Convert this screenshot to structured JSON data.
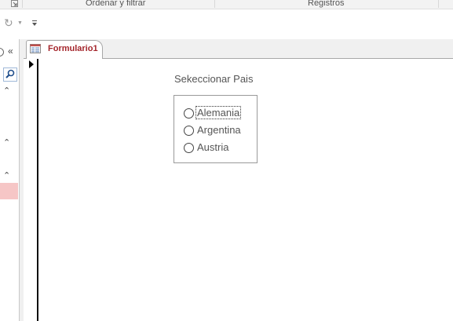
{
  "ribbon": {
    "groups": [
      {
        "label": "Ordenar y filtrar"
      },
      {
        "label": "Registros"
      }
    ]
  },
  "quick_access": {
    "items": [
      "redo-icon",
      "redo-dropdown-icon",
      "customize-qat-icon"
    ]
  },
  "navigation_pane": {
    "icons": [
      "shutter-open-icon",
      "search-icon",
      "collapse-group-icon"
    ]
  },
  "document": {
    "tab_label": "Formulario1",
    "tab_icon": "form-icon"
  },
  "form": {
    "option_group_label": "Sekeccionar Pais",
    "options": [
      {
        "label": "Alemania",
        "selected": false,
        "focused": true
      },
      {
        "label": "Argentina",
        "selected": false,
        "focused": false
      },
      {
        "label": "Austria",
        "selected": false,
        "focused": false
      }
    ]
  },
  "colors": {
    "tab_text": "#a4262c",
    "nav_selection": "#f6c6c6",
    "ribbon_bg": "#f3f3f3"
  }
}
